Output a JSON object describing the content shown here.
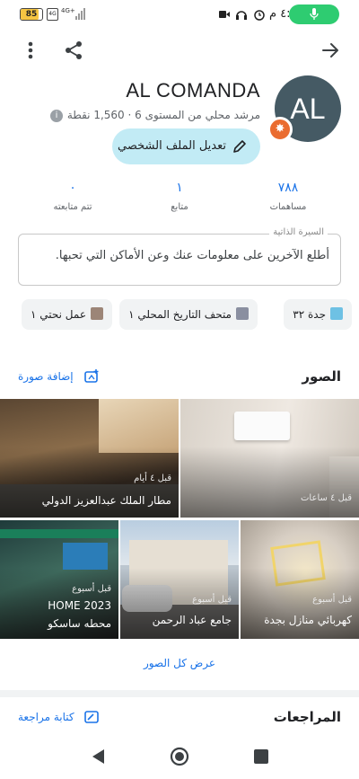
{
  "status_bar": {
    "battery": "85",
    "sim": "4G",
    "network": "4G+",
    "time": "٤:٣٤ م"
  },
  "profile": {
    "name": "AL COMANDA",
    "avatar_initials": "AL",
    "level_text": "مرشد محلي من المستوى 6 · 1,560 نقطة",
    "edit_button": "تعديل الملف الشخصي"
  },
  "stats": [
    {
      "value": "٧٨٨",
      "label": "مساهمات"
    },
    {
      "value": "١",
      "label": "متابع"
    },
    {
      "value": "٠",
      "label": "تتم متابعته"
    }
  ],
  "bio": {
    "legend": "السيرة الذاتية",
    "placeholder": "أطلع الآخرين على معلومات عنك وعن الأماكن التي تحبها."
  },
  "chips": [
    {
      "label": "جدة ٣٢",
      "icon": "city-icon"
    },
    {
      "label": "متحف التاريخ المحلي ١",
      "icon": "museum-icon"
    },
    {
      "label": "عمل نحتي ١",
      "icon": "sculpture-icon"
    }
  ],
  "photos": {
    "title": "الصور",
    "add_label": "إضافة صورة",
    "items": [
      {
        "when": "قبل ٤ ساعات",
        "title": ""
      },
      {
        "when": "قبل ٤ أيام",
        "title": "مطار الملك عبدالعزيز الدولي"
      },
      {
        "when": "قبل أسبوع",
        "title": "كهربائي منازل بجدة"
      },
      {
        "when": "قبل أسبوع",
        "title": "جامع عباد الرحمن"
      },
      {
        "when": "قبل أسبوع",
        "title": "HOME 2023",
        "title2": "محطه ساسكو"
      }
    ],
    "view_all": "عرض كل الصور"
  },
  "reviews": {
    "title": "المراجعات",
    "write_label": "كتابة مراجعة"
  },
  "colors": {
    "accent": "#1a73e8",
    "button_bg": "#c2ebf5",
    "avatar_bg": "#455a64",
    "badge": "#ea6c30",
    "mic_pill": "#2ecc71"
  }
}
